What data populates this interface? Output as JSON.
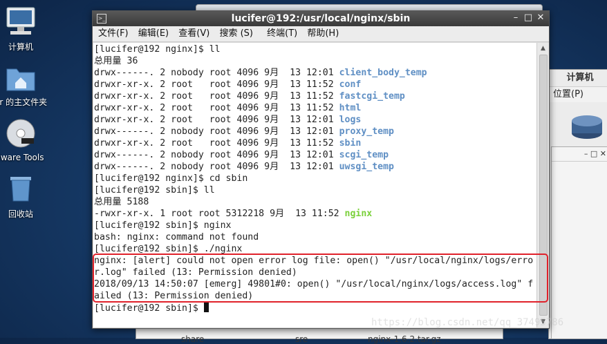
{
  "desktop": {
    "icons": [
      {
        "label": "计算机"
      },
      {
        "label": "fer 的主文件夹"
      },
      {
        "label": "Mware Tools"
      },
      {
        "label": "回收站"
      }
    ]
  },
  "background_windows": {
    "right": {
      "title": "计算机",
      "menu": "位置(P)"
    },
    "bottom": {
      "items": [
        "share",
        "sre",
        "nginx-1.6.2.tar.gz"
      ]
    }
  },
  "terminal": {
    "title": "lucifer@192:/usr/local/nginx/sbin",
    "menu": [
      "文件(F)",
      "编辑(E)",
      "查看(V)",
      "搜索 (S)",
      "终端(T)",
      "帮助(H)"
    ],
    "lines": [
      {
        "text": "[lucifer@192 nginx]$ ll"
      },
      {
        "text": "总用量 36"
      },
      {
        "text": "drwx------. 2 nobody root 4096 9月  13 12:01 ",
        "name": "client_body_temp",
        "style": "dir"
      },
      {
        "text": "drwxr-xr-x. 2 root   root 4096 9月  13 11:52 ",
        "name": "conf",
        "style": "dir"
      },
      {
        "text": "drwxr-xr-x. 2 root   root 4096 9月  13 11:52 ",
        "name": "fastcgi_temp",
        "style": "dir"
      },
      {
        "text": "drwxr-xr-x. 2 root   root 4096 9月  13 11:52 ",
        "name": "html",
        "style": "dir"
      },
      {
        "text": "drwxr-xr-x. 2 root   root 4096 9月  13 12:01 ",
        "name": "logs",
        "style": "dir"
      },
      {
        "text": "drwx------. 2 nobody root 4096 9月  13 12:01 ",
        "name": "proxy_temp",
        "style": "dir"
      },
      {
        "text": "drwxr-xr-x. 2 root   root 4096 9月  13 11:52 ",
        "name": "sbin",
        "style": "dir"
      },
      {
        "text": "drwx------. 2 nobody root 4096 9月  13 12:01 ",
        "name": "scgi_temp",
        "style": "dir"
      },
      {
        "text": "drwx------. 2 nobody root 4096 9月  13 12:01 ",
        "name": "uwsgi_temp",
        "style": "dir"
      },
      {
        "text": "[lucifer@192 nginx]$ cd sbin"
      },
      {
        "text": "[lucifer@192 sbin]$ ll"
      },
      {
        "text": "总用量 5188"
      },
      {
        "text": "-rwxr-xr-x. 1 root root 5312218 9月  13 11:52 ",
        "name": "nginx",
        "style": "exe"
      },
      {
        "text": "[lucifer@192 sbin]$ nginx"
      },
      {
        "text": "bash: nginx: command not found"
      },
      {
        "text": "[lucifer@192 sbin]$ ./nginx"
      },
      {
        "text": "nginx: [alert] could not open error log file: open() \"/usr/local/nginx/logs/erro"
      },
      {
        "text": "r.log\" failed (13: Permission denied)"
      },
      {
        "text": "2018/09/13 14:50:07 [emerg] 49801#0: open() \"/usr/local/nginx/logs/access.log\" f"
      },
      {
        "text": "ailed (13: Permission denied)"
      },
      {
        "text": "[lucifer@192 sbin]$ ",
        "cursor": true
      }
    ]
  },
  "watermark": "https://blog.csdn.net/qq_37495786",
  "colors": {
    "dir": "#5f8fc4",
    "exe": "#7ad03a",
    "highlight": "#e0202a"
  }
}
